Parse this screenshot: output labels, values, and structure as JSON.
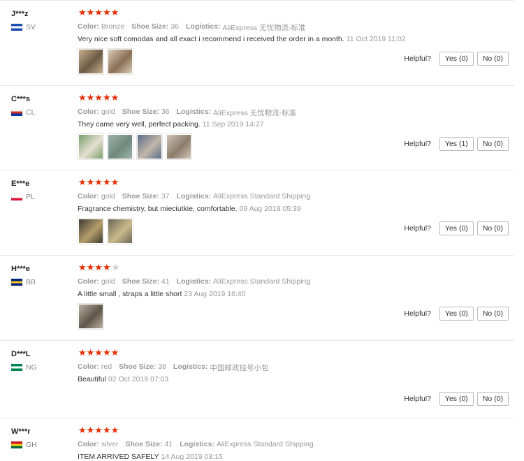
{
  "reviews": [
    {
      "user": "J***z",
      "country": "SV",
      "flag": [
        "#1f4fb5",
        "#ffffff",
        "#1f4fb5"
      ],
      "stars": "★★★★★",
      "stars_off": "",
      "color_label": "Color:",
      "color": "Bronze",
      "size_label": "Shoe Size:",
      "size": "36",
      "logistics_label": "Logistics:",
      "logistics": "AliExpress 无忧物流-标准",
      "text": "Very nice soft comodas and all exact i recommend i received the order in a month.",
      "date": "11 Oct 2019 11:02",
      "images": [
        [
          "#c7b08a",
          "#6b5a46"
        ],
        [
          "#d9cdb8",
          "#8a6f55"
        ]
      ],
      "helpful_label": "Helpful?",
      "yes": "Yes (0)",
      "no": "No (0)"
    },
    {
      "user": "C***s",
      "country": "CL",
      "flag": [
        "#ffffff",
        "#d52b1e",
        "#0039a6"
      ],
      "stars": "★★★★★",
      "stars_off": "",
      "color_label": "Color:",
      "color": "gold",
      "size_label": "Shoe Size:",
      "size": "36",
      "logistics_label": "Logistics:",
      "logistics": "AliExpress 无忧物流-标准",
      "text": "They came very well, perfect packing.",
      "date": "11 Sep 2019 14:27",
      "images": [
        [
          "#7aa06a",
          "#e5e0d0"
        ],
        [
          "#9fb2a8",
          "#6e8a7c"
        ],
        [
          "#5a6e8a",
          "#c2b6a8"
        ],
        [
          "#cfc5b8",
          "#8c7c6a"
        ]
      ],
      "helpful_label": "Helpful?",
      "yes": "Yes (1)",
      "no": "No (0)"
    },
    {
      "user": "E***e",
      "country": "PL",
      "flag": [
        "#ffffff",
        "#ffffff",
        "#dc143c"
      ],
      "stars": "★★★★★",
      "stars_off": "",
      "color_label": "Color:",
      "color": "gold",
      "size_label": "Shoe Size:",
      "size": "37",
      "logistics_label": "Logistics:",
      "logistics": "AliExpress Standard Shipping",
      "text": "Fragrance chemistry, but mieciutkie, comfortable.",
      "date": "09 Aug 2019 05:39",
      "images": [
        [
          "#3e3a34",
          "#b59d6a"
        ],
        [
          "#6b6656",
          "#c9b98a"
        ]
      ],
      "helpful_label": "Helpful?",
      "yes": "Yes (0)",
      "no": "No (0)"
    },
    {
      "user": "H***e",
      "country": "BB",
      "flag": [
        "#00267f",
        "#ffc726",
        "#00267f"
      ],
      "stars": "★★★★",
      "stars_off": "★",
      "color_label": "Color:",
      "color": "gold",
      "size_label": "Shoe Size:",
      "size": "41",
      "logistics_label": "Logistics:",
      "logistics": "AliExpress Standard Shipping",
      "text": "A little small , straps a little short",
      "date": "23 Aug 2019 16:40",
      "images": [
        [
          "#b9b0a0",
          "#5e5548"
        ]
      ],
      "helpful_label": "Helpful?",
      "yes": "Yes (0)",
      "no": "No (0)"
    },
    {
      "user": "D***L",
      "country": "NG",
      "flag": [
        "#008751",
        "#ffffff",
        "#008751"
      ],
      "stars": "★★★★★",
      "stars_off": "",
      "color_label": "Color:",
      "color": "red",
      "size_label": "Shoe Size:",
      "size": "38",
      "logistics_label": "Logistics:",
      "logistics": "中国邮政挂号小包",
      "text": "Beautiful",
      "date": "02 Oct 2019 07:03",
      "images": [],
      "helpful_label": "Helpful?",
      "yes": "Yes (0)",
      "no": "No (0)"
    },
    {
      "user": "W***r",
      "country": "GH",
      "flag": [
        "#ce1126",
        "#fcd116",
        "#006b3f"
      ],
      "stars": "★★★★★",
      "stars_off": "",
      "color_label": "Color:",
      "color": "silver",
      "size_label": "Shoe Size:",
      "size": "41",
      "logistics_label": "Logistics:",
      "logistics": "AliExpress Standard Shipping",
      "text": "ITEM ARRIVED SAFELY",
      "date": "14 Aug 2019 03:15",
      "images": [],
      "helpful_label": "",
      "yes": "",
      "no": ""
    }
  ]
}
